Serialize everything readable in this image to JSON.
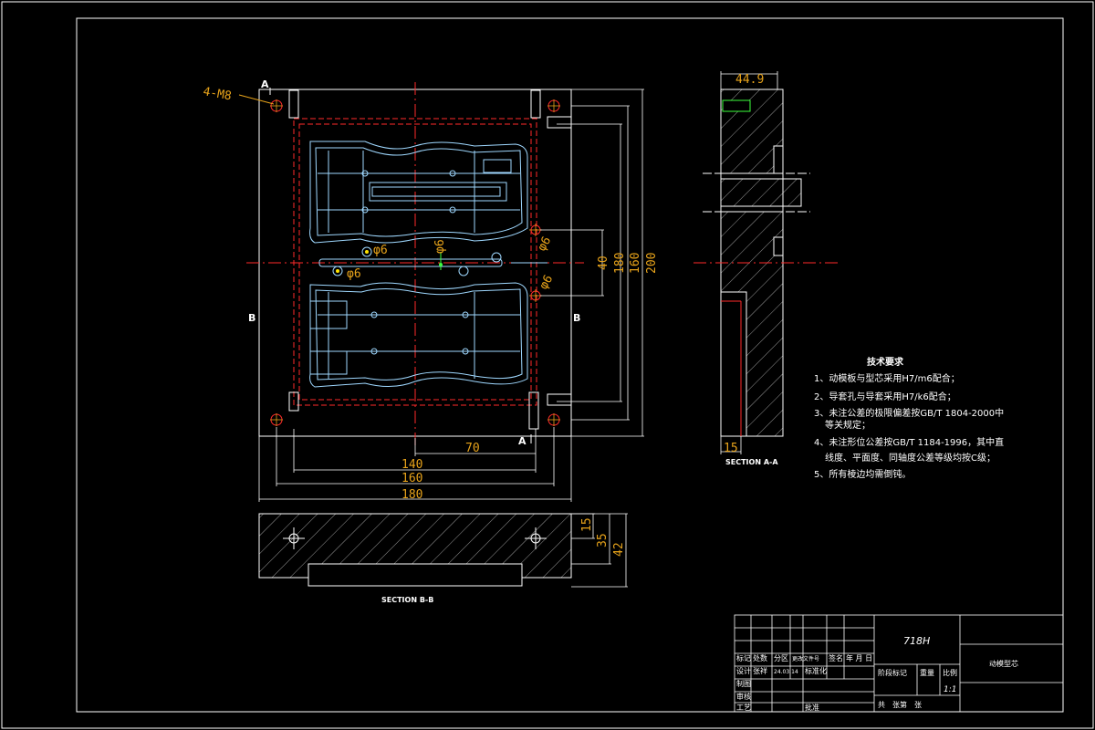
{
  "drawing": {
    "labels": {
      "thread_callout": "4-M8",
      "dim_40": "40",
      "dim_180_v": "180",
      "dim_200": "200",
      "dim_70": "70",
      "dim_140": "140",
      "dim_160": "160",
      "dim_180_h": "180",
      "dim_44_9": "44.9",
      "dim_15_side": "15",
      "dim_15_b": "15",
      "dim_35": "35",
      "dim_42": "42",
      "phi6_a": "φ6",
      "phi6_b": "φ6",
      "phi6_c": "φ6",
      "phi6_d": "φ6",
      "phi6_e": "φ6",
      "sec_a_top": "A",
      "sec_a_bottom": "A",
      "sec_b_left": "B",
      "sec_b_right": "B",
      "section_aa": "SECTION A-A",
      "section_bb": "SECTION B-B"
    },
    "tech_req": {
      "title": "技术要求",
      "items": [
        "1、动模板与型芯采用H7/m6配合；",
        "2、导套孔与导套采用H7/k6配合；",
        "3、未注公差的极限偏差按GB/T 1804-2000中",
        "等关规定；",
        "4、未注形位公差按GB/T 1184-1996，其中直",
        "线度、平面度、同轴度公差等级均按C级；",
        "5、所有棱边均需倒钝。"
      ]
    },
    "title_block": {
      "material": "718H",
      "part_name": "动模型芯",
      "scale_label": "比例",
      "scale": "1:1",
      "weight_label": "重量",
      "stage_label": "阶段标记",
      "sheets": "共　张第　张",
      "row_mark": "标记",
      "row_count": "处数",
      "row_zone": "分区",
      "row_change": "更改文件号",
      "row_sign": "签名",
      "row_date": "年 月 日",
      "design": "设计",
      "designer": "张祥",
      "date": "24.03.14",
      "std": "标准化",
      "drawn": "制图",
      "check": "审核",
      "process": "工艺",
      "approve": "批准"
    }
  }
}
